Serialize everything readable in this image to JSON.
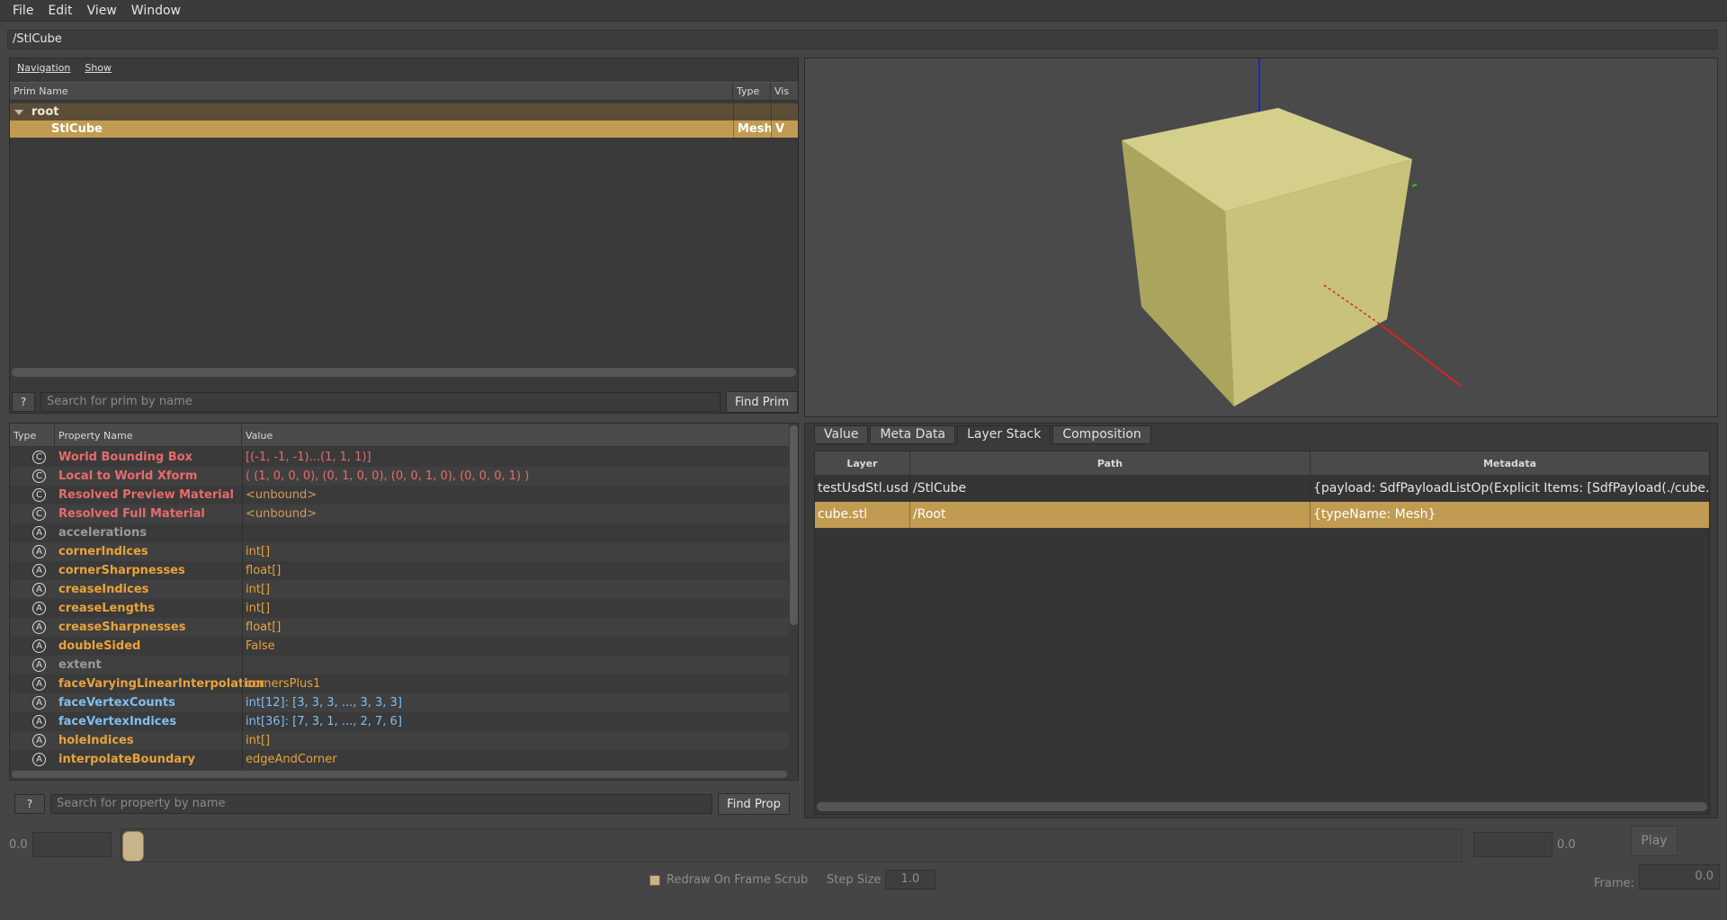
{
  "menu": [
    "File",
    "Edit",
    "View",
    "Window"
  ],
  "path": "/StlCube",
  "prim_browser": {
    "menus": [
      "Navigation",
      "Show"
    ],
    "columns": {
      "name": "Prim Name",
      "type": "Type",
      "vis": "Vis"
    },
    "root": {
      "name": "root"
    },
    "selected": {
      "name": "StlCube",
      "type": "Mesh",
      "vis": "V"
    },
    "search_placeholder": "Search for prim by name",
    "help_label": "?",
    "find_label": "Find Prim"
  },
  "properties": {
    "columns": {
      "type": "Type",
      "name": "Property Name",
      "value": "Value"
    },
    "rows": [
      {
        "icon": "C",
        "name": "World Bounding Box",
        "value": "[(-1, -1, -1)...(1, 1, 1)]",
        "name_color": "#e86b6b",
        "value_color": "#e86b6b"
      },
      {
        "icon": "C",
        "name": "Local to World Xform",
        "value": "( (1, 0, 0, 0), (0, 1, 0, 0), (0, 0, 1, 0), (0, 0, 0, 1) )",
        "name_color": "#e86b6b",
        "value_color": "#e86b6b"
      },
      {
        "icon": "C",
        "name": "Resolved Preview Material",
        "value": "<unbound>",
        "name_color": "#e86b6b",
        "value_color": "#d49a5a"
      },
      {
        "icon": "C",
        "name": "Resolved Full Material",
        "value": "<unbound>",
        "name_color": "#e86b6b",
        "value_color": "#d49a5a"
      },
      {
        "icon": "A",
        "name": "accelerations",
        "value": "",
        "name_color": "#9a9a9a",
        "value_color": "#9a9a9a"
      },
      {
        "icon": "A",
        "name": "cornerIndices",
        "value": "int[]",
        "name_color": "#e8a33a",
        "value_color": "#e8a33a"
      },
      {
        "icon": "A",
        "name": "cornerSharpnesses",
        "value": "float[]",
        "name_color": "#e8a33a",
        "value_color": "#e8a33a"
      },
      {
        "icon": "A",
        "name": "creaseIndices",
        "value": "int[]",
        "name_color": "#e8a33a",
        "value_color": "#e8a33a"
      },
      {
        "icon": "A",
        "name": "creaseLengths",
        "value": "int[]",
        "name_color": "#e8a33a",
        "value_color": "#e8a33a"
      },
      {
        "icon": "A",
        "name": "creaseSharpnesses",
        "value": "float[]",
        "name_color": "#e8a33a",
        "value_color": "#e8a33a"
      },
      {
        "icon": "A",
        "name": "doubleSided",
        "value": "False",
        "name_color": "#e8a33a",
        "value_color": "#e8a33a"
      },
      {
        "icon": "A",
        "name": "extent",
        "value": "",
        "name_color": "#9a9a9a",
        "value_color": "#9a9a9a"
      },
      {
        "icon": "A",
        "name": "faceVaryingLinearInterpolation",
        "value": "cornersPlus1",
        "name_color": "#e8a33a",
        "value_color": "#e8a33a"
      },
      {
        "icon": "A",
        "name": "faceVertexCounts",
        "value": "int[12]: [3, 3, 3, ..., 3, 3, 3]",
        "name_color": "#7fbff0",
        "value_color": "#7fbff0"
      },
      {
        "icon": "A",
        "name": "faceVertexIndices",
        "value": "int[36]: [7, 3, 1, ..., 2, 7, 6]",
        "name_color": "#7fbff0",
        "value_color": "#7fbff0"
      },
      {
        "icon": "A",
        "name": "holeIndices",
        "value": "int[]",
        "name_color": "#e8a33a",
        "value_color": "#e8a33a"
      },
      {
        "icon": "A",
        "name": "interpolateBoundary",
        "value": "edgeAndCorner",
        "name_color": "#e8a33a",
        "value_color": "#e8a33a"
      }
    ],
    "search_placeholder": "Search for property by name",
    "help_label": "?",
    "find_label": "Find Prop"
  },
  "right_tabs": [
    "Value",
    "Meta Data",
    "Layer Stack",
    "Composition"
  ],
  "layer_stack": {
    "columns": {
      "layer": "Layer",
      "path": "Path",
      "metadata": "Metadata"
    },
    "rows": [
      {
        "layer": "testUsdStl.usda",
        "path": "/StlCube",
        "metadata": "{payload: SdfPayloadListOp(Explicit Items: [SdfPayload(./cube.stl, , ..."
      },
      {
        "layer": "cube.stl",
        "path": "/Root",
        "metadata": "{typeName: Mesh}"
      }
    ]
  },
  "timeline": {
    "start_value": "0.0",
    "end_value": "0.0",
    "play_label": "Play",
    "redraw_label": "Redraw On Frame Scrub",
    "step_label": "Step Size",
    "step_value": "1.0",
    "frame_label": "Frame:",
    "frame_value": "0.0"
  },
  "colors": {
    "selection": "#c19b52",
    "cube": "#c8c27a"
  }
}
